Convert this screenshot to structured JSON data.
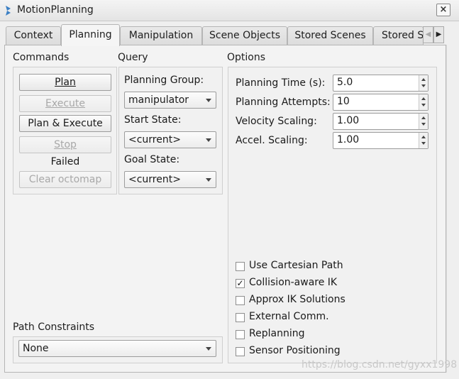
{
  "window": {
    "title": "MotionPlanning",
    "close_label": "×"
  },
  "tabs": [
    "Context",
    "Planning",
    "Manipulation",
    "Scene Objects",
    "Stored Scenes",
    "Stored S"
  ],
  "tab_scroll": {
    "left": "◀",
    "right": "▶"
  },
  "commands": {
    "heading": "Commands",
    "plan": "Plan",
    "execute": "Execute",
    "plan_execute": "Plan & Execute",
    "stop": "Stop",
    "status": "Failed",
    "clear_octomap": "Clear octomap"
  },
  "query": {
    "heading": "Query",
    "planning_group_label": "Planning Group:",
    "planning_group_value": "manipulator",
    "start_state_label": "Start State:",
    "start_state_value": "<current>",
    "goal_state_label": "Goal State:",
    "goal_state_value": "<current>"
  },
  "options": {
    "heading": "Options",
    "planning_time_label": "Planning Time (s):",
    "planning_time_value": "5.0",
    "planning_attempts_label": "Planning Attempts:",
    "planning_attempts_value": "10",
    "velocity_scaling_label": "Velocity Scaling:",
    "velocity_scaling_value": "1.00",
    "accel_scaling_label": "Accel. Scaling:",
    "accel_scaling_value": "1.00",
    "checkboxes": [
      {
        "label": "Use Cartesian Path",
        "checked": false
      },
      {
        "label": "Collision-aware IK",
        "checked": true
      },
      {
        "label": "Approx IK Solutions",
        "checked": false
      },
      {
        "label": "External Comm.",
        "checked": false
      },
      {
        "label": "Replanning",
        "checked": false
      },
      {
        "label": "Sensor Positioning",
        "checked": false
      }
    ]
  },
  "path_constraints": {
    "heading": "Path Constraints",
    "value": "None"
  },
  "watermark": "https://blog.csdn.net/gyxx1998",
  "check_mark": "✓"
}
